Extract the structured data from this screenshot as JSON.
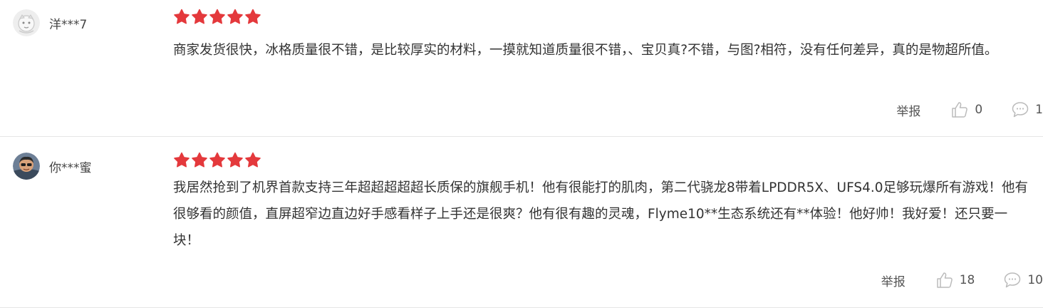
{
  "reviews": [
    {
      "username": "洋***7",
      "rating": 5,
      "content": "商家发货很快，冰格质量很不错，是比较厚实的材料，一摸就知道质量很不错，、宝贝真?不错，与图?相符，没有任何差异，真的是物超所值。",
      "report_label": "举报",
      "likes": "0",
      "comments": "1"
    },
    {
      "username": "你***蜜",
      "rating": 5,
      "content": "我居然抢到了机界首款支持三年超超超超超长质保的旗舰手机！他有很能打的肌肉，第二代骁龙8带着LPDDR5X、UFS4.0足够玩爆所有游戏！他有很够看的颜值，直屏超窄边直边好手感看样子上手还是很爽？他有很有趣的灵魂，Flyme10**生态系统还有**体验！他好帅！我好爱！还只要一块！",
      "report_label": "举报",
      "likes": "18",
      "comments": "10"
    }
  ],
  "colors": {
    "star": "#e4393c",
    "divider": "#e6e6e6",
    "text": "#333333",
    "muted": "#555555",
    "icon": "#bbbbbb"
  },
  "icons": {
    "like": "thumbs-up-icon",
    "comment": "speech-bubble-icon",
    "star": "star-icon"
  }
}
